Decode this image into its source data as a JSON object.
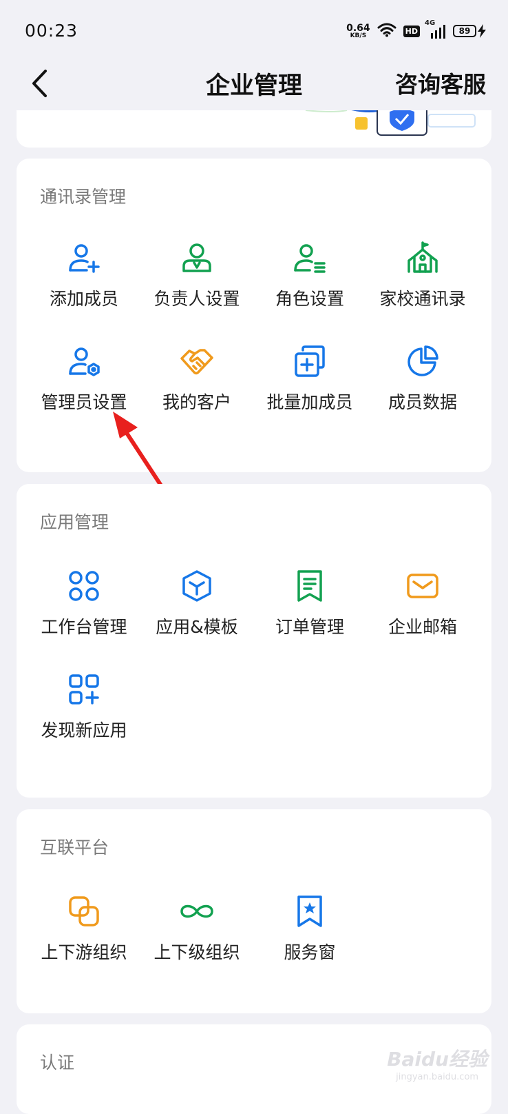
{
  "status_bar": {
    "time": "00:23",
    "net_speed_value": "0.64",
    "net_speed_unit": "KB/S",
    "hd_label": "HD",
    "network_type": "4G",
    "battery": "89"
  },
  "nav": {
    "title": "企业管理",
    "consult_label": "咨询客服"
  },
  "sections": {
    "contacts": {
      "title": "通讯录管理",
      "items": [
        {
          "label": "添加成员",
          "icon": "add-user-icon"
        },
        {
          "label": "负责人设置",
          "icon": "person-in-charge-icon"
        },
        {
          "label": "角色设置",
          "icon": "role-icon"
        },
        {
          "label": "家校通讯录",
          "icon": "school-icon"
        },
        {
          "label": "管理员设置",
          "icon": "admin-settings-icon"
        },
        {
          "label": "我的客户",
          "icon": "handshake-icon"
        },
        {
          "label": "批量加成员",
          "icon": "batch-add-icon"
        },
        {
          "label": "成员数据",
          "icon": "pie-chart-icon"
        }
      ]
    },
    "apps": {
      "title": "应用管理",
      "items": [
        {
          "label": "工作台管理",
          "icon": "workbench-icon"
        },
        {
          "label": "应用&模板",
          "icon": "cube-icon"
        },
        {
          "label": "订单管理",
          "icon": "order-icon"
        },
        {
          "label": "企业邮箱",
          "icon": "mail-icon"
        },
        {
          "label": "发现新应用",
          "icon": "discover-apps-icon"
        }
      ]
    },
    "interconnect": {
      "title": "互联平台",
      "items": [
        {
          "label": "上下游组织",
          "icon": "link-icon"
        },
        {
          "label": "上下级组织",
          "icon": "infinity-icon"
        },
        {
          "label": "服务窗",
          "icon": "bookmark-star-icon"
        }
      ]
    },
    "certification": {
      "title": "认证"
    }
  },
  "watermark": {
    "text": "Baidu经验",
    "sub": "jingyan.baidu.com"
  },
  "colors": {
    "blue": "#1677e8",
    "green": "#12a150",
    "orange": "#f09a1c",
    "annotation_red": "#e8201e"
  }
}
